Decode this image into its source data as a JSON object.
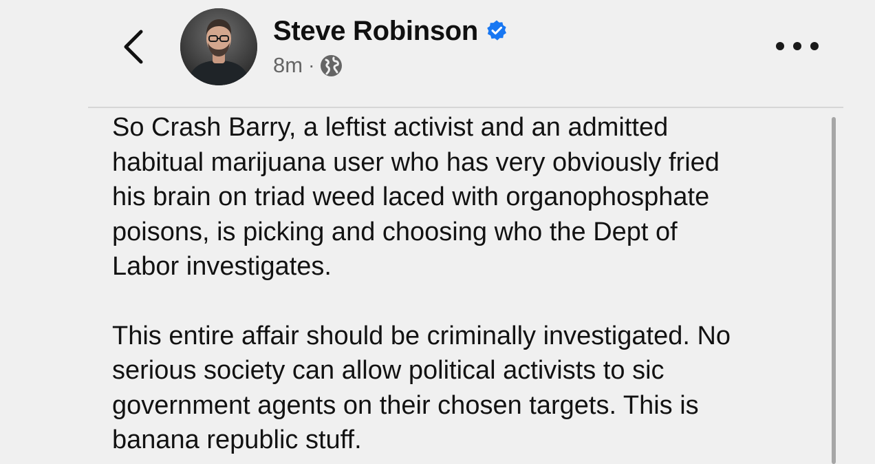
{
  "header": {
    "author": {
      "name": "Steve Robinson",
      "verified": true,
      "verified_color": "#1877f2"
    },
    "timestamp": "8m",
    "separator": "·",
    "audience_icon": "globe-icon",
    "back_icon": "chevron-left-icon",
    "more_icon": "more-options-icon"
  },
  "post": {
    "paragraphs": [
      "So Crash Barry, a leftist activist and an admitted\nhabitual marijuana user who has very obviously fried\nhis brain on triad weed laced with organophosphate\npoisons, is picking and choosing who the Dept of\nLabor investigates.",
      "This entire affair should be criminally investigated. No\nserious society can allow political activists to sic\ngovernment agents on their chosen targets. This is\nbanana republic stuff."
    ]
  },
  "colors": {
    "background": "#f0f0f0",
    "text": "#121212",
    "meta_text": "#656565",
    "verified_badge": "#1877f2"
  }
}
